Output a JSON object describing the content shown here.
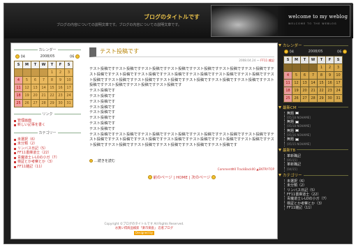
{
  "header": {
    "blog_title": "ブログのタイトルです",
    "blog_desc": "ブログの内容についての説明文章です。ブログの内容についての説明文章です。",
    "banner_welcome": "welcome to my weblog",
    "banner_sub": "WELCOME TO THE WEBLOG"
  },
  "left": {
    "calendar_heading": "カレンダー",
    "cal_prev": "04",
    "cal_month": "2008/05",
    "cal_next": "06",
    "weekdays": [
      "S",
      "M",
      "T",
      "W",
      "T",
      "F",
      "S"
    ],
    "weeks": [
      [
        "",
        "",
        "",
        "",
        "1",
        "2",
        "3"
      ],
      [
        "4",
        "5",
        "6",
        "7",
        "8",
        "9",
        "10"
      ],
      [
        "11",
        "12",
        "13",
        "14",
        "15",
        "16",
        "17"
      ],
      [
        "18",
        "19",
        "20",
        "21",
        "22",
        "23",
        "24"
      ],
      [
        "25",
        "26",
        "27",
        "28",
        "29",
        "30",
        "31"
      ]
    ],
    "links_heading": "リンク",
    "links": [
      "管理画面",
      "新しい記事を書く"
    ],
    "categories_heading": "カテゴリー",
    "categories": [
      "未選択（6）",
      "未分類（2）",
      "リンバス日記（5）",
      "FF11書庫道士（22）",
      "青魔道士レLOの小ガ（7）",
      "検証とか考察とか（3）",
      "FF11雑記（11）"
    ]
  },
  "post": {
    "title": "テスト投稿です",
    "date": "2008.04.24 ～",
    "category": "FF11 雑記",
    "para1": "テスト投稿ですテスト投稿ですテスト投稿ですテスト投稿ですテスト投稿ですテスト投稿ですテスト投稿ですテスト投稿ですテスト投稿ですテスト投稿ですテスト投稿ですテスト投稿ですテスト投稿ですテスト投稿ですテスト投稿ですテスト投稿ですテスト投稿ですテスト投稿ですテスト投稿ですテスト投稿ですテスト投稿ですテスト投稿ですテスト投稿ですテスト投稿ですテスト投稿です",
    "short_lines": [
      "テスト投稿です",
      "テスト投稿です",
      "テスト投稿です",
      "テスト投稿です",
      "テスト投稿です",
      "テスト投稿です",
      "テスト投稿です",
      "テスト投稿です"
    ],
    "para2": "テスト投稿ですテスト投稿ですテスト投稿ですテスト投稿ですテスト投稿ですテスト投稿ですテスト投稿ですテスト投稿ですテスト投稿ですテスト投稿ですテスト投稿ですテスト投稿ですテスト投稿ですテスト投稿ですテスト投稿ですテスト投稿ですテスト投稿ですテスト投稿ですテスト投稿ですテスト投稿です",
    "read_more": "…続きを読む",
    "footer_links": "CommentΦ0  TrackBack00  ▲ENTRY-TOP"
  },
  "pager": {
    "prev": "前のページ",
    "home": "HOME",
    "next": "次のページ"
  },
  "footer": {
    "copyright": "Copyright ©ブログのタイトルです All Rights Reserved.",
    "line2": "お買い得商品検索「楽市楽座」 忍者ブログ",
    "designed": "Designed by"
  },
  "right": {
    "calendar_heading": "カレンダー",
    "cal_prev": "04",
    "cal_month": "2008/05",
    "cal_next": "06",
    "weekdays": [
      "S",
      "M",
      "T",
      "W",
      "T",
      "F",
      "S"
    ],
    "weeks": [
      [
        "",
        "",
        "",
        "",
        "1",
        "2",
        "3"
      ],
      [
        "4",
        "5",
        "6",
        "7",
        "8",
        "9",
        "10"
      ],
      [
        "11",
        "12",
        "13",
        "14",
        "15",
        "16",
        "17"
      ],
      [
        "18",
        "19",
        "20",
        "21",
        "22",
        "23",
        "24"
      ],
      [
        "25",
        "26",
        "27",
        "28",
        "29",
        "30",
        "31"
      ]
    ],
    "recent_comments_heading": "最新CM",
    "recent_comments": [
      {
        "title": "無題",
        "meta": "[05/18 NOHAME]"
      },
      {
        "title": "無題",
        "meta": "[05/18 NOHAME]"
      },
      {
        "title": "無題",
        "meta": "[05/16 NOHAME]"
      },
      {
        "title": "無題",
        "meta": "[05/15 NOHAME]"
      }
    ],
    "recent_tb_heading": "最新TB",
    "recent_tb": [
      {
        "title": "革新職記",
        "meta": "[05/15]"
      },
      {
        "title": "革新職記",
        "meta": "[04/15]"
      }
    ],
    "categories_heading": "カテゴリー",
    "categories": [
      "未選択（6）",
      "未分類（2）",
      "リンバス日記（5）",
      "FF11書庫道士（22）",
      "青魔道士レLOの小ガ（7）",
      "検証とか考察とか（3）",
      "FF11雑記（11）"
    ]
  }
}
